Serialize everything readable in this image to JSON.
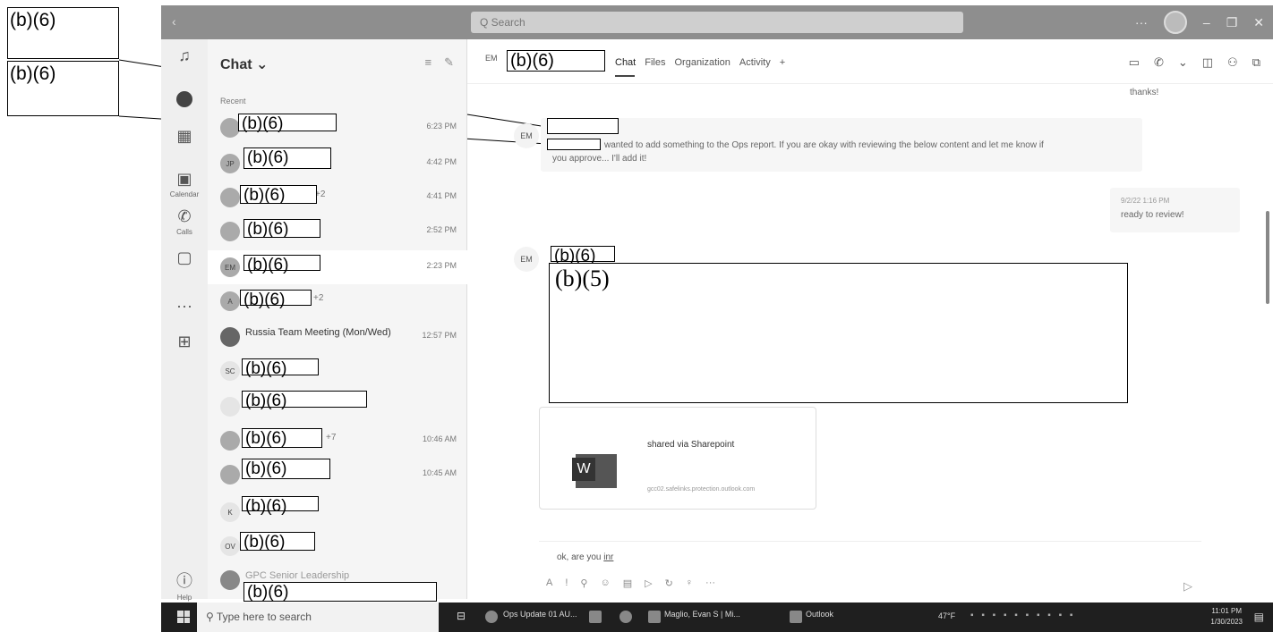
{
  "redaction_labels": {
    "b6": "(b)(6)",
    "b5": "(b)(5)"
  },
  "window": {
    "search_placeholder": "Q Search"
  },
  "rail": {
    "calendar": "Calendar",
    "calls": "Calls",
    "help": "Help"
  },
  "chatlist": {
    "title": "Chat ⌄",
    "recent": "Recent",
    "rows": [
      {
        "time": "6:23 PM",
        "avatar": ""
      },
      {
        "time": "4:42 PM",
        "avatar": "JP"
      },
      {
        "time": "4:41 PM",
        "avatar": "",
        "suffix": "+2"
      },
      {
        "time": "2:52 PM",
        "avatar": ""
      },
      {
        "time": "2:23 PM",
        "avatar": "EM"
      },
      {
        "time": "",
        "avatar": "A",
        "suffix": "+2"
      },
      {
        "time": "12:57 PM",
        "avatar": "",
        "name": "Russia Team Meeting (Mon/Wed)"
      },
      {
        "time": "",
        "avatar": "SC"
      },
      {
        "time": "",
        "avatar": ""
      },
      {
        "time": "10:46 AM",
        "avatar": "",
        "suffix": "+7"
      },
      {
        "time": "10:45 AM",
        "avatar": ""
      },
      {
        "time": "",
        "avatar": "K"
      },
      {
        "time": "",
        "avatar": "OV"
      },
      {
        "time": "",
        "avatar": "",
        "name": "GPC Senior Leadership"
      }
    ]
  },
  "header": {
    "avatar": "EM",
    "tabs": [
      "Chat",
      "Files",
      "Organization",
      "Activity",
      "+"
    ]
  },
  "messages": {
    "thanks": "thanks!",
    "m1_avatar": "EM",
    "m1_line1": "wanted to add something to the Ops report. If you are okay with reviewing the below content and let me know if",
    "m1_line2": "you approve... I'll add it!",
    "m2_meta": "9/2/22 1:16 PM",
    "m2_text": "ready to review!",
    "m3_avatar": "EM"
  },
  "attachment": {
    "title": "shared via Sharepoint",
    "url": "gcc02.safelinks.protection.outlook.com",
    "word_letter": "W"
  },
  "compose": {
    "text_before": "ok, are you ",
    "text_underlined": "inr"
  },
  "taskbar": {
    "search": "Type here to search",
    "app1": "Ops Update 01 AU...",
    "app2": "Maglio, Evan S | Mi...",
    "app3": "Outlook",
    "temp": "47°F",
    "time": "11:01 PM",
    "date": "1/30/2023"
  }
}
